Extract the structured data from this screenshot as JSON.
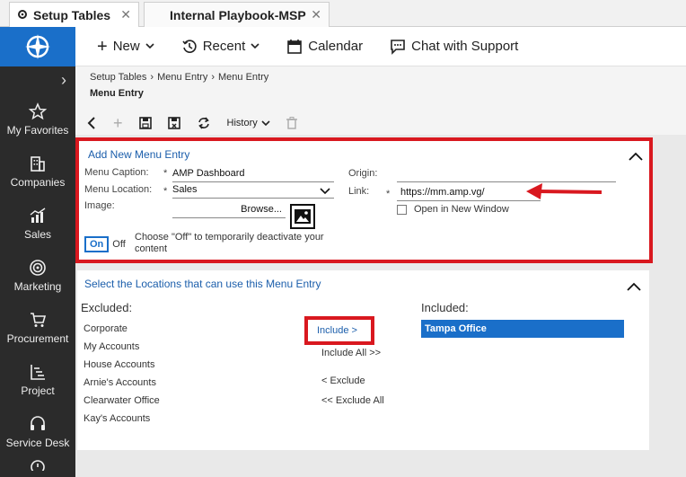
{
  "tabs": [
    {
      "label": "Setup Tables",
      "close": "✕"
    },
    {
      "label": "Internal Playbook-MSP",
      "close": "✕"
    }
  ],
  "sidebar": {
    "items": [
      {
        "label": "My Favorites",
        "icon": "star-icon"
      },
      {
        "label": "Companies",
        "icon": "building-icon"
      },
      {
        "label": "Sales",
        "icon": "chart-icon"
      },
      {
        "label": "Marketing",
        "icon": "target-icon"
      },
      {
        "label": "Procurement",
        "icon": "cart-icon"
      },
      {
        "label": "Project",
        "icon": "project-icon"
      },
      {
        "label": "Service Desk",
        "icon": "headset-icon"
      }
    ]
  },
  "topbar": {
    "new_label": "New",
    "recent_label": "Recent",
    "calendar_label": "Calendar",
    "chat_label": "Chat with Support"
  },
  "breadcrumb": {
    "items": [
      "Setup Tables",
      "Menu Entry",
      "Menu Entry"
    ],
    "title": "Menu Entry"
  },
  "actions": {
    "history_label": "History"
  },
  "form": {
    "title": "Add New Menu Entry",
    "caption_label": "Menu Caption:",
    "caption_value": "AMP Dashboard",
    "location_label": "Menu Location:",
    "location_value": "Sales",
    "image_label": "Image:",
    "browse_label": "Browse...",
    "origin_label": "Origin:",
    "link_label": "Link:",
    "link_value": "https://mm.amp.vg/",
    "new_window_label": "Open in New Window",
    "required_mark": "*",
    "toggle_on": "On",
    "toggle_off": "Off",
    "toggle_hint": "Choose \"Off\" to temporarily deactivate your content"
  },
  "locations": {
    "title": "Select the Locations that can use this Menu Entry",
    "excluded_label": "Excluded:",
    "included_label": "Included:",
    "excluded_items": [
      "Corporate",
      "My Accounts",
      "House Accounts",
      "Arnie's Accounts",
      "Clearwater Office",
      "Kay's Accounts"
    ],
    "included_items": [
      "Tampa Office"
    ],
    "include_label": "Include >",
    "include_all_label": "Include All >>",
    "exclude_label": "< Exclude",
    "exclude_all_label": "<< Exclude All"
  },
  "colors": {
    "accent": "#1a6fc9",
    "highlight_red": "#d9181f",
    "sidebar_bg": "#2b2b2b"
  }
}
